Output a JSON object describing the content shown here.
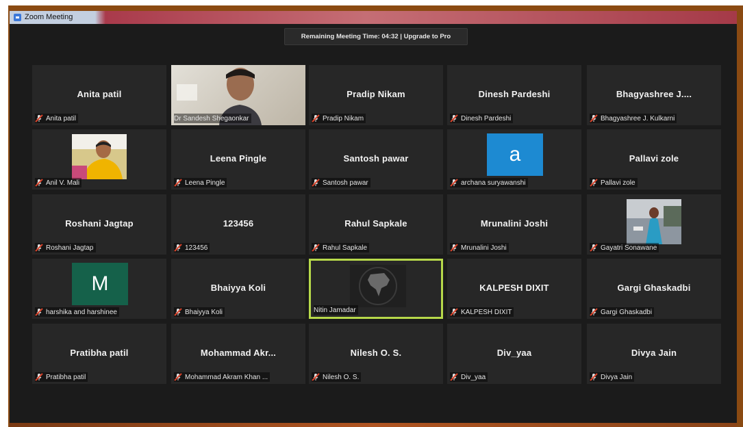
{
  "window": {
    "title": "Zoom Meeting"
  },
  "banner": {
    "text": "Remaining Meeting Time: 04:32 | Upgrade to Pro"
  },
  "colors": {
    "active_speaker_border": "#b7d94a",
    "avatar_a": "#1d8ad2",
    "avatar_m": "#15614a",
    "muted_icon": "#d9442c"
  },
  "participants": [
    {
      "display": "Anita patil",
      "label": "Anita patil",
      "kind": "name",
      "muted": true
    },
    {
      "display": "",
      "label": "Dr Sandesh Shegaonkar",
      "kind": "video",
      "muted": false
    },
    {
      "display": "Pradip Nikam",
      "label": "Pradip Nikam",
      "kind": "name",
      "muted": true
    },
    {
      "display": "Dinesh Pardeshi",
      "label": "Dinesh Pardeshi",
      "kind": "name",
      "muted": true
    },
    {
      "display": "Bhagyashree J....",
      "label": "Bhagyashree J. Kulkarni",
      "kind": "name",
      "muted": true
    },
    {
      "display": "",
      "label": "Anil V. Mali",
      "kind": "photo",
      "muted": true
    },
    {
      "display": "Leena Pingle",
      "label": "Leena Pingle",
      "kind": "name",
      "muted": true
    },
    {
      "display": "Santosh pawar",
      "label": "Santosh pawar",
      "kind": "name",
      "muted": true
    },
    {
      "display": "a",
      "label": "archana suryawanshi",
      "kind": "avatar",
      "muted": true
    },
    {
      "display": "Pallavi zole",
      "label": "Pallavi zole",
      "kind": "name",
      "muted": true
    },
    {
      "display": "Roshani Jagtap",
      "label": "Roshani Jagtap",
      "kind": "name",
      "muted": true
    },
    {
      "display": "123456",
      "label": "123456",
      "kind": "name",
      "muted": true
    },
    {
      "display": "Rahul Sapkale",
      "label": "Rahul Sapkale",
      "kind": "name",
      "muted": true
    },
    {
      "display": "Mrunalini Joshi",
      "label": "Mrunalini Joshi",
      "kind": "name",
      "muted": true
    },
    {
      "display": "",
      "label": "Gayatri Sonawane",
      "kind": "photo",
      "muted": true
    },
    {
      "display": "M",
      "label": "harshika and harshinee",
      "kind": "avatar",
      "muted": true
    },
    {
      "display": "Bhaiyya Koli",
      "label": "Bhaiyya Koli",
      "kind": "name",
      "muted": true
    },
    {
      "display": "",
      "label": "Nitin Jamadar",
      "kind": "art",
      "muted": false,
      "active_speaker": true
    },
    {
      "display": "KALPESH DIXIT",
      "label": "KALPESH DIXIT",
      "kind": "name",
      "muted": true
    },
    {
      "display": "Gargi Ghaskadbi",
      "label": "Gargi Ghaskadbi",
      "kind": "name",
      "muted": true
    },
    {
      "display": "Pratibha patil",
      "label": "Pratibha patil",
      "kind": "name",
      "muted": true
    },
    {
      "display": "Mohammad Akr...",
      "label": "Mohammad Akram Khan ...",
      "kind": "name",
      "muted": true
    },
    {
      "display": "Nilesh O. S.",
      "label": "Nilesh O. S.",
      "kind": "name",
      "muted": true
    },
    {
      "display": "Div_yaa",
      "label": "Div_yaa",
      "kind": "name",
      "muted": true
    },
    {
      "display": "Divya Jain",
      "label": "Divya Jain",
      "kind": "name",
      "muted": true
    }
  ]
}
